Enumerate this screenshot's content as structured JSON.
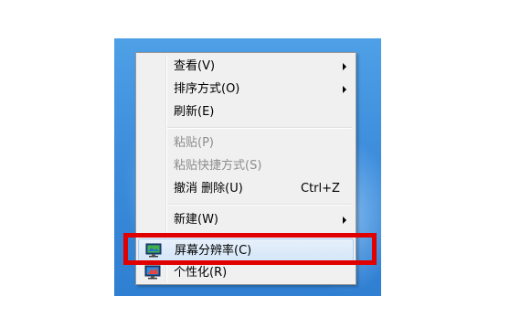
{
  "context_menu": {
    "items": [
      {
        "label": "查看(V)",
        "submenu": true,
        "enabled": true
      },
      {
        "label": "排序方式(O)",
        "submenu": true,
        "enabled": true
      },
      {
        "label": "刷新(E)",
        "submenu": false,
        "enabled": true
      },
      {
        "label": "粘贴(P)",
        "submenu": false,
        "enabled": false
      },
      {
        "label": "粘贴快捷方式(S)",
        "submenu": false,
        "enabled": false
      },
      {
        "label": "撤消 删除(U)",
        "shortcut": "Ctrl+Z",
        "submenu": false,
        "enabled": true
      },
      {
        "label": "新建(W)",
        "submenu": true,
        "enabled": true
      },
      {
        "label": "屏幕分辨率(C)",
        "icon": "screen-resolution-icon",
        "submenu": false,
        "enabled": true,
        "hovered": true
      },
      {
        "label": "个性化(R)",
        "icon": "personalize-icon",
        "submenu": false,
        "enabled": true
      }
    ]
  },
  "colors": {
    "highlight_border": "#e10000",
    "desktop_background": "#3d8ddc",
    "menu_background": "#f0f0f0",
    "hover_background": "#d4e6f8"
  }
}
